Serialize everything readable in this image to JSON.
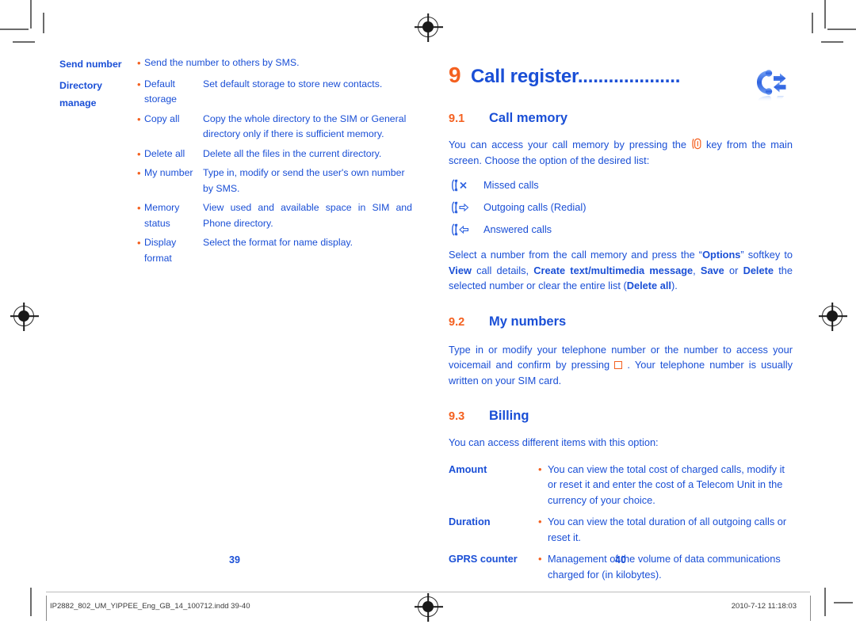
{
  "document": {
    "left_page": {
      "page_number": "39",
      "options": [
        {
          "label_line1": "Send number",
          "label_line2": "",
          "entries": [
            {
              "bullet": "•",
              "name": "",
              "desc": "Send the number to others by SMS."
            }
          ]
        },
        {
          "label_line1": "Directory",
          "label_line2": "manage",
          "entries": [
            {
              "bullet": "•",
              "name": "Default storage",
              "desc": "Set default storage to store new contacts."
            },
            {
              "bullet": "•",
              "name": "Copy all",
              "desc": "Copy the whole directory to the SIM or General directory only if there is sufficient memory."
            },
            {
              "bullet": "•",
              "name": "Delete all",
              "desc": "Delete all the files in the current directory."
            },
            {
              "bullet": "•",
              "name": "My number",
              "desc": "Type in, modify or send the user's own number by SMS."
            },
            {
              "bullet": "•",
              "name": "Memory status",
              "desc": "View used and available space in SIM and Phone directory."
            },
            {
              "bullet": "•",
              "name": "Display format",
              "desc": "Select the format for name display."
            }
          ]
        }
      ]
    },
    "right_page": {
      "page_number": "40",
      "chapter": {
        "number": "9",
        "title": "Call register",
        "leader": "....................",
        "icon": "call-register-icon"
      },
      "sections": [
        {
          "number": "9.1",
          "title": "Call memory",
          "intro_part1": "You can access your call memory by pressing the ",
          "intro_key_icon": "key-glyph-icon",
          "intro_part2": " key from the main screen. Choose the option of the desired list:",
          "call_items": [
            {
              "icon": "missed-call-icon",
              "label": "Missed calls"
            },
            {
              "icon": "outgoing-call-icon",
              "label": "Outgoing calls (Redial)"
            },
            {
              "icon": "answered-call-icon",
              "label": "Answered calls"
            }
          ],
          "outro": {
            "t1": "Select a number from the call memory and press the “",
            "b1": "Options",
            "t2": "” softkey to ",
            "b2": "View",
            "t3": " call details, ",
            "b3": "Create text/multimedia message",
            "t4": ", ",
            "b4": "Save",
            "t5": " or ",
            "b5": "Delete",
            "t6": " the selected number or clear the entire list (",
            "b6": "Delete all",
            "t7": ")."
          }
        },
        {
          "number": "9.2",
          "title": "My numbers",
          "body_part1": "Type in or modify your telephone number or the number to access your voicemail and confirm by pressing ",
          "body_square_icon": "square-key-icon",
          "body_part2": " . Your telephone number is usually written on your SIM card."
        },
        {
          "number": "9.3",
          "title": "Billing",
          "intro": "You can access different items with this option:",
          "rows": [
            {
              "label": "Amount",
              "bullet": "•",
              "text": "You can view the total cost of charged calls, modify it or reset it and enter the cost of a Telecom Unit in the currency of your choice."
            },
            {
              "label": "Duration",
              "bullet": "•",
              "text": "You can view the total duration of all outgoing calls or reset it."
            },
            {
              "label": "GPRS counter",
              "bullet": "•",
              "text": "Management of the volume of data communications charged for (in kilobytes)."
            }
          ]
        }
      ]
    },
    "footer": {
      "filename": "IP2882_802_UM_YIPPEE_Eng_GB_14_100712.indd   39-40",
      "timestamp": "2010-7-12   11:18:03"
    },
    "colors": {
      "blue": "#1a4fd6",
      "orange": "#f4601f",
      "footer_gray": "#3a3a3a"
    }
  }
}
